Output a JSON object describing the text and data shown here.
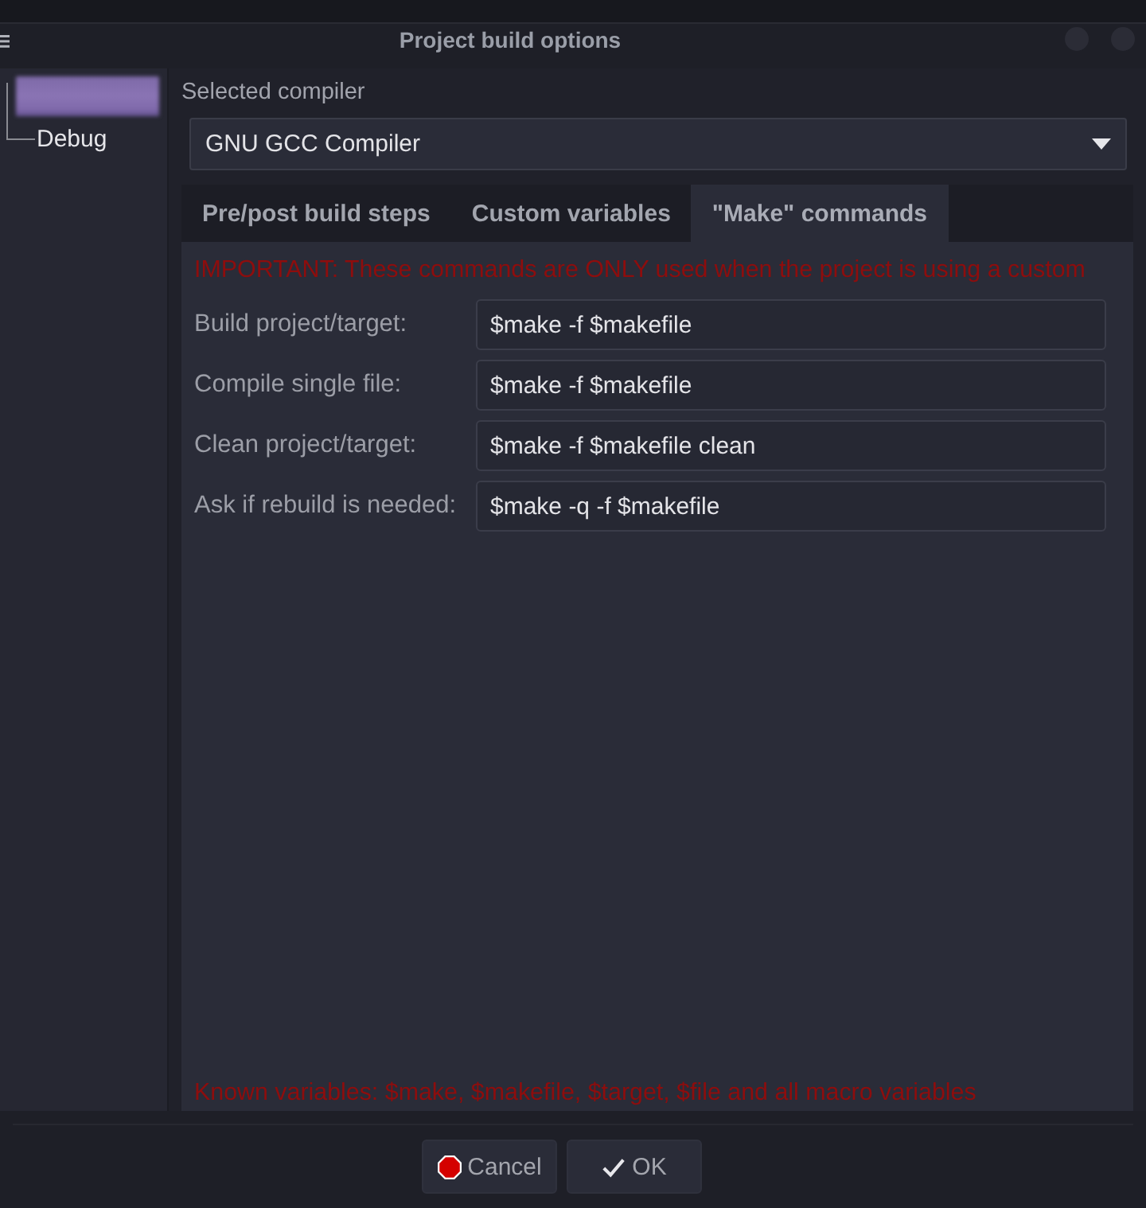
{
  "window": {
    "title": "Project build options"
  },
  "tree": [
    {
      "selected": true,
      "children": [
        {
          "label": "Debug",
          "selected": false
        }
      ]
    }
  ],
  "compiler": {
    "label": "Selected compiler",
    "value": "GNU GCC Compiler"
  },
  "tabs": [
    {
      "label": "Pre/post build steps",
      "selected": false
    },
    {
      "label": "Custom variables",
      "selected": false
    },
    {
      "label": "\"Make\" commands",
      "selected": true
    }
  ],
  "make_commands": {
    "notice": "IMPORTANT: These commands are ONLY used when the project is using a custom",
    "fields": [
      {
        "label": "Build project/target:",
        "value": "$make -f $makefile"
      },
      {
        "label": "Compile single file:",
        "value": "$make -f $makefile"
      },
      {
        "label": "Clean project/target:",
        "value": "$make -f $makefile clean"
      },
      {
        "label": "Ask if rebuild is needed:",
        "value": "$make -q -f $makefile"
      }
    ],
    "footnote": "Known variables: $make, $makefile, $target, $file and all macro variables"
  },
  "buttons": [
    {
      "kind": "cancel",
      "label": "Cancel"
    },
    {
      "kind": "ok",
      "label": "OK"
    }
  ]
}
